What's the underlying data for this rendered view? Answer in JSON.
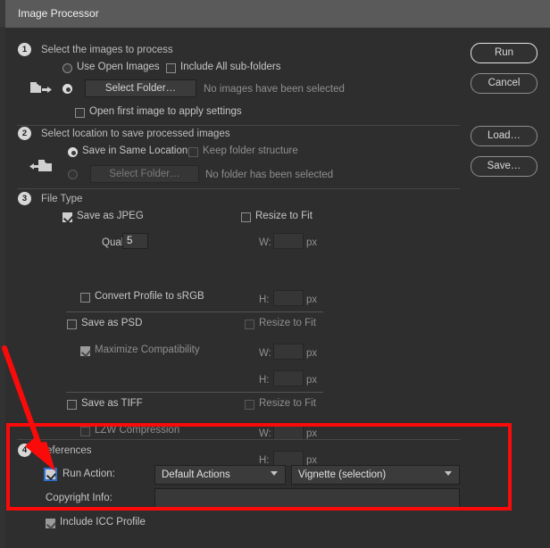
{
  "window": {
    "title": "Image Processor"
  },
  "sections": {
    "one": {
      "number": "1",
      "heading": "Select the images to process",
      "use_open_images": "Use Open Images",
      "include_subfolders": "Include All sub-folders",
      "select_folder_button": "Select Folder…",
      "folder_status": "No images have been selected",
      "open_first_image": "Open first image to apply settings",
      "folder_icon": "folder-export-icon"
    },
    "two": {
      "number": "2",
      "heading": "Select location to save processed images",
      "save_same_location": "Save in Same Location",
      "keep_folder_structure": "Keep folder structure",
      "select_folder_button": "Select Folder…",
      "folder_status": "No folder has been selected",
      "folder_icon": "folder-import-icon"
    },
    "three": {
      "number": "3",
      "heading": "File Type",
      "jpeg": {
        "save_as": "Save as JPEG",
        "resize_to_fit": "Resize to Fit",
        "quality_label": "Quality:",
        "quality_value": "5",
        "w_label": "W:",
        "w_value": "",
        "h_label": "H:",
        "h_value": "",
        "px": "px",
        "convert_srgb": "Convert Profile to sRGB"
      },
      "psd": {
        "save_as": "Save as PSD",
        "resize_to_fit": "Resize to Fit",
        "maximize_compatibility": "Maximize Compatibility",
        "w_label": "W:",
        "w_value": "",
        "h_label": "H:",
        "h_value": "",
        "px": "px"
      },
      "tiff": {
        "save_as": "Save as TIFF",
        "resize_to_fit": "Resize to Fit",
        "lzw_compression": "LZW Compression",
        "w_label": "W:",
        "w_value": "",
        "h_label": "H:",
        "h_value": "",
        "px": "px"
      }
    },
    "four": {
      "number": "4",
      "heading": "eferences",
      "run_action": "Run Action:",
      "action_set": "Default Actions",
      "action_name": "Vignette (selection)",
      "copyright_label": "Copyright Info:",
      "copyright_value": "",
      "include_icc": "Include ICC Profile"
    }
  },
  "buttons": {
    "run": "Run",
    "cancel": "Cancel",
    "load": "Load…",
    "save": "Save…"
  },
  "annotation": {
    "color": "#fb0a0a",
    "box_name": "red-highlight-box",
    "arrow_name": "red-arrow-pointer"
  }
}
